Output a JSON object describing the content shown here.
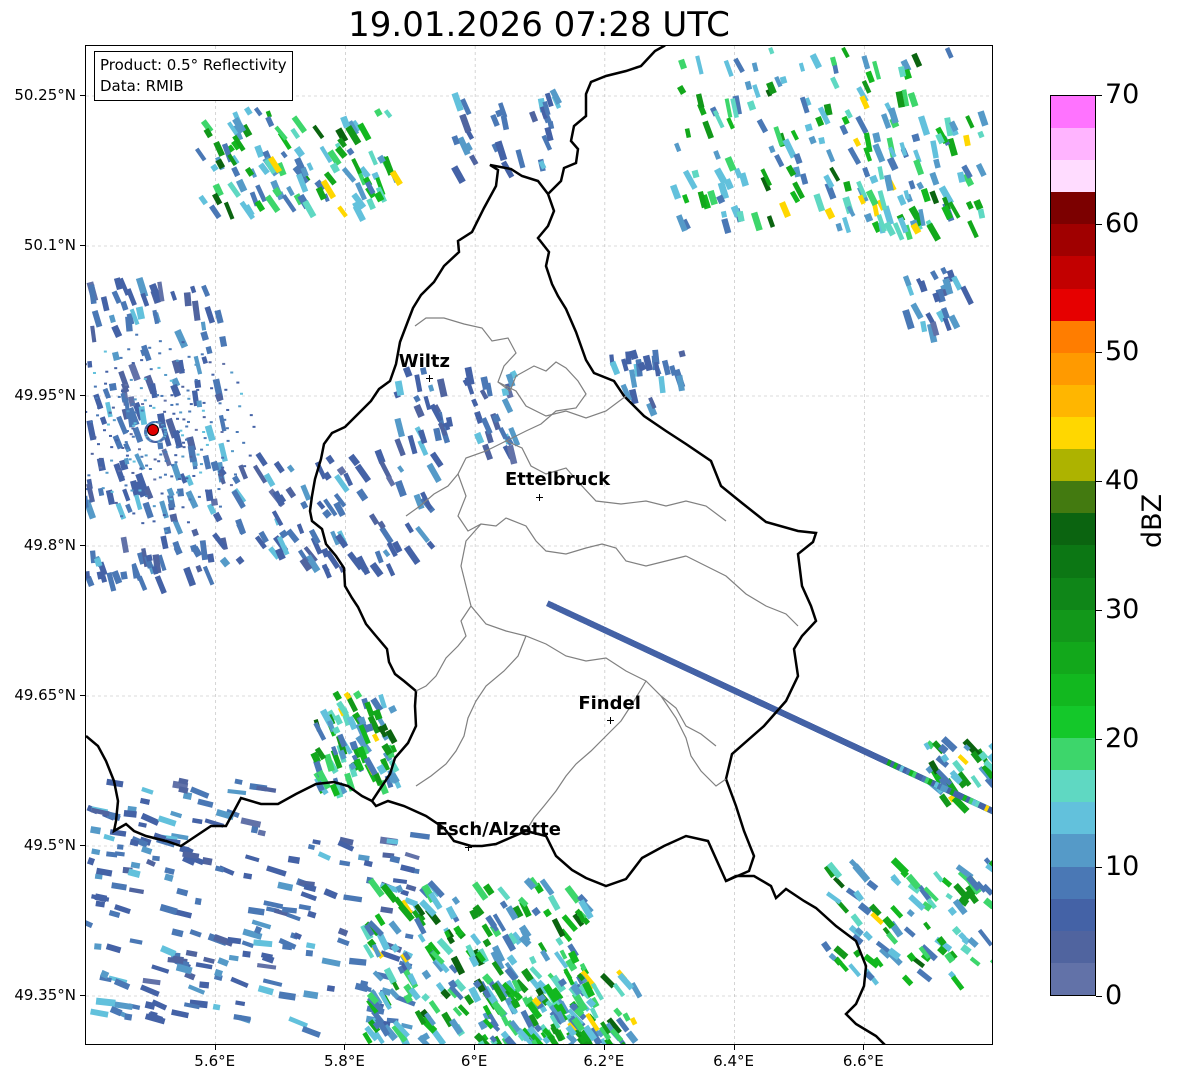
{
  "title": "19.01.2026 07:28 UTC",
  "info": {
    "product": "Product: 0.5° Reflectivity",
    "data": "Data: RMIB"
  },
  "axes": {
    "lat_labels": [
      "50.25°N",
      "50.1°N",
      "49.95°N",
      "49.8°N",
      "49.65°N",
      "49.5°N",
      "49.35°N"
    ],
    "lon_labels": [
      "5.6°E",
      "5.8°E",
      "6°E",
      "6.2°E",
      "6.4°E",
      "6.6°E"
    ]
  },
  "map_extent": {
    "lon_min": 5.4,
    "lon_max": 6.8,
    "lat_min": 49.3,
    "lat_max": 50.3
  },
  "cities": [
    {
      "name": "Wiltz",
      "lon": 5.93,
      "lat": 49.967
    },
    {
      "name": "Ettelbruck",
      "lon": 6.1,
      "lat": 49.848
    },
    {
      "name": "Findel",
      "lon": 6.21,
      "lat": 49.625
    },
    {
      "name": "Esch/Alzette",
      "lon": 5.99,
      "lat": 49.498
    }
  ],
  "radar_site": {
    "lon": 5.505,
    "lat": 49.915
  },
  "colorbar": {
    "label": "dBZ",
    "min": 0,
    "max": 70,
    "step": 2.5,
    "tick_labels": [
      "0",
      "10",
      "20",
      "30",
      "40",
      "50",
      "60",
      "70"
    ],
    "colors": [
      "#6272a8",
      "#50649f",
      "#4462a6",
      "#4a78b5",
      "#559ac8",
      "#62c1dc",
      "#5fd8c2",
      "#3dd66b",
      "#14c82a",
      "#12b81f",
      "#12a81b",
      "#12981a",
      "#0f8618",
      "#0c7714",
      "#0b6410",
      "#437a10",
      "#adb300",
      "#ffd700",
      "#ffb600",
      "#ff9a00",
      "#ff7d00",
      "#e60000",
      "#c20000",
      "#a00000",
      "#7c0000",
      "#ffdcff",
      "#ffb4ff",
      "#ff73ff",
      "#ee3cee"
    ]
  }
}
